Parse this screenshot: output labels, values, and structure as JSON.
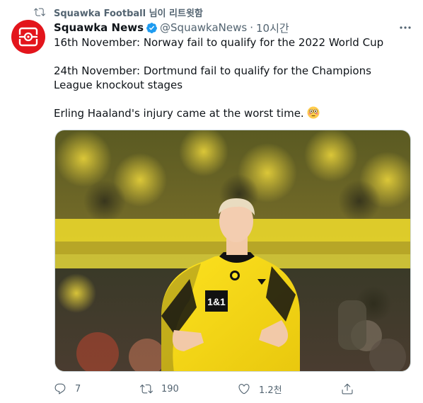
{
  "retweet_context": {
    "text": "Squawka Football 님이 리트윗함"
  },
  "author": {
    "name": "Squawka News",
    "handle": "@SquawkaNews",
    "separator": "·",
    "time": "10시간"
  },
  "tweet": {
    "lines": [
      "16th November: Norway fail to qualify for the 2022 World Cup",
      "24th November: Dortmund fail to qualify for the Champions League knockout stages",
      "Erling Haaland's injury came at the worst time."
    ]
  },
  "media": {
    "shirt_sponsor": "1&1"
  },
  "actions": {
    "reply_count": "7",
    "retweet_count": "190",
    "like_count": "1.2천"
  },
  "colors": {
    "brand_red": "#e3151c",
    "verified_blue": "#1d9bf0",
    "muted": "#536471",
    "text": "#0f1419"
  },
  "icons": [
    "retweet-icon",
    "verified-icon",
    "more-icon",
    "reply-icon",
    "like-icon",
    "share-icon",
    "flushed-face-emoji"
  ]
}
